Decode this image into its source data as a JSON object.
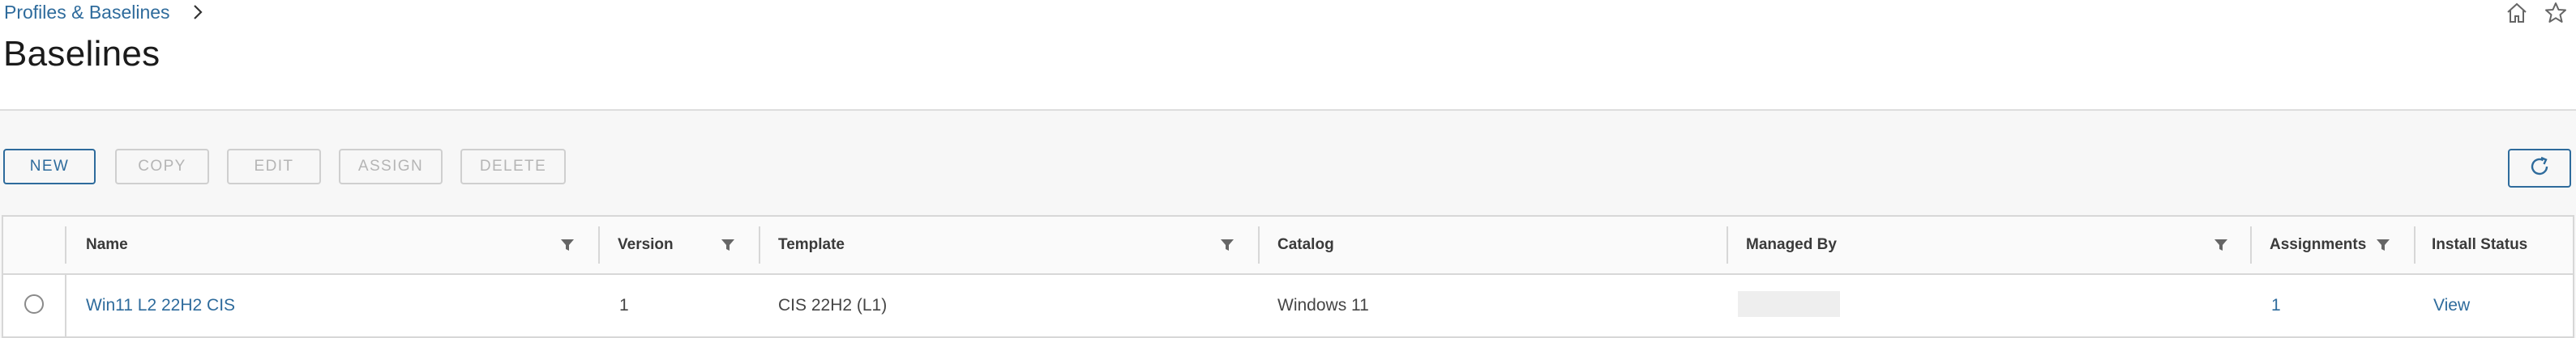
{
  "breadcrumb": {
    "parent": "Profiles & Baselines"
  },
  "page": {
    "title": "Baselines"
  },
  "toolbar": {
    "new_label": "NEW",
    "copy_label": "COPY",
    "edit_label": "EDIT",
    "assign_label": "ASSIGN",
    "delete_label": "DELETE"
  },
  "table": {
    "columns": [
      "Name",
      "Version",
      "Template",
      "Catalog",
      "Managed By",
      "Assignments",
      "Install Status"
    ],
    "rows": [
      {
        "name": "Win11 L2 22H2 CIS",
        "version": "1",
        "template": "CIS 22H2 (L1)",
        "catalog": "Windows 11",
        "managed_by": "",
        "assignments": "1",
        "install_status": "View"
      }
    ]
  },
  "icons": {
    "breadcrumb_separator": "chevron-right-icon",
    "home": "home-icon",
    "favorite": "star-icon",
    "refresh": "refresh-icon",
    "filter": "filter-icon",
    "row_select": "radio-button"
  },
  "colors": {
    "accent": "#2e6b9c",
    "disabled": "#b5b5b5",
    "background": "#f7f7f7"
  }
}
